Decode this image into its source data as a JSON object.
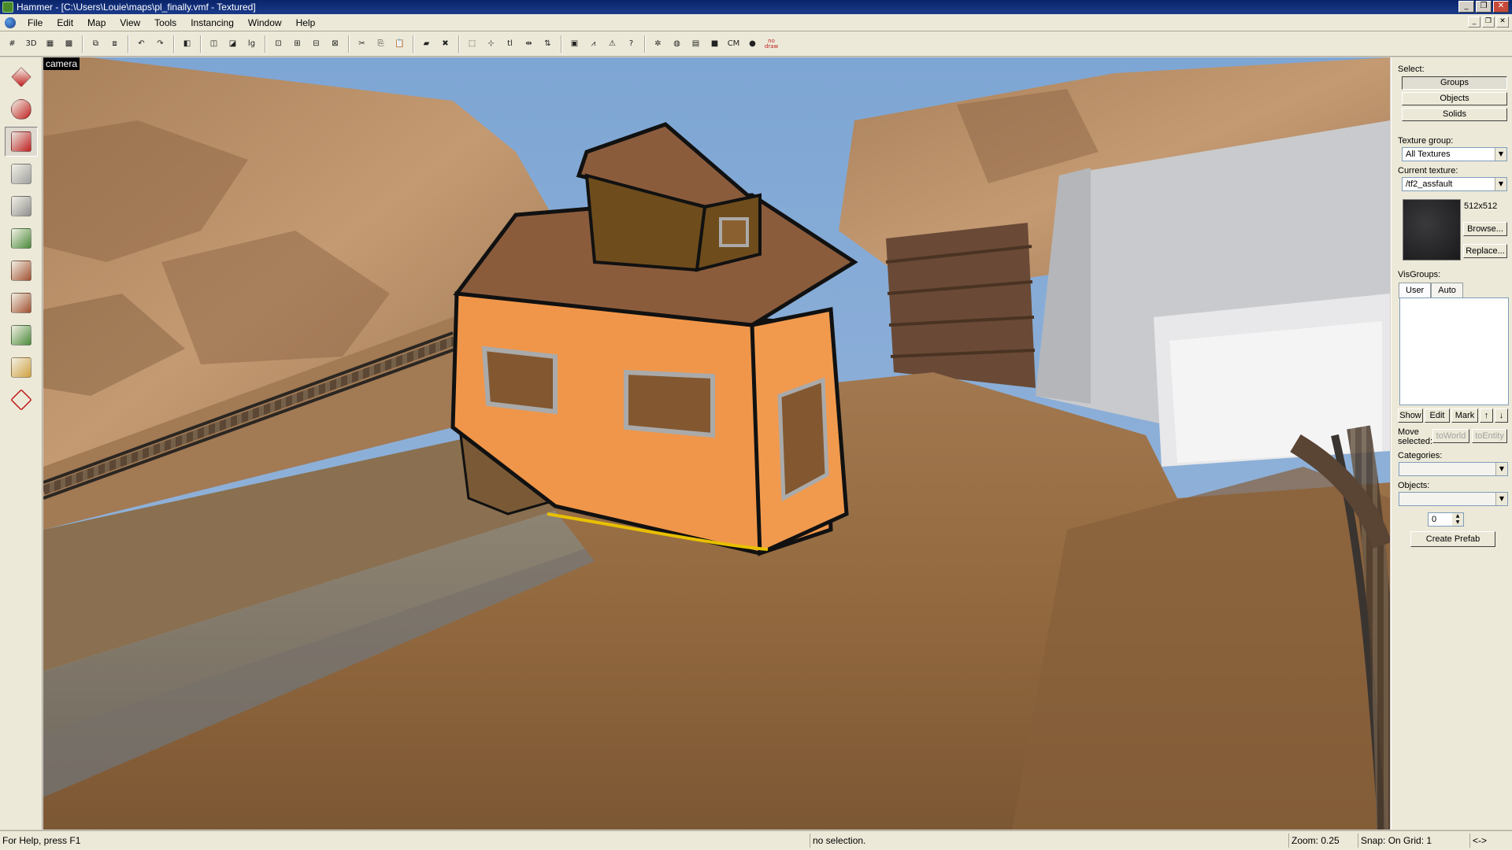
{
  "window": {
    "title": "Hammer - [C:\\Users\\Louie\\maps\\pl_finally.vmf - Textured]",
    "minimize": "_",
    "restore": "❐",
    "close": "✕"
  },
  "menu": {
    "items": [
      "File",
      "Edit",
      "Map",
      "View",
      "Tools",
      "Instancing",
      "Window",
      "Help"
    ]
  },
  "toolbar": {
    "groups": [
      [
        {
          "name": "grid-toggle-icon",
          "glyph": "#"
        },
        {
          "name": "3d-grid-icon",
          "glyph": "3D"
        },
        {
          "name": "grid-smaller-icon",
          "glyph": "▦"
        },
        {
          "name": "grid-larger-icon",
          "glyph": "▩"
        }
      ],
      [
        {
          "name": "group-icon",
          "glyph": "⧉"
        },
        {
          "name": "ungroup-icon",
          "glyph": "⧈"
        }
      ],
      [
        {
          "name": "undo-icon",
          "glyph": "↶"
        },
        {
          "name": "redo-icon",
          "glyph": "↷"
        }
      ],
      [
        {
          "name": "carve-icon",
          "glyph": "◧"
        }
      ],
      [
        {
          "name": "hide-selected-icon",
          "glyph": "◫"
        },
        {
          "name": "hide-unselected-icon",
          "glyph": "◪"
        },
        {
          "name": "show-all-icon",
          "glyph": "lg"
        }
      ],
      [
        {
          "name": "cordon-red-icon",
          "glyph": "⊡"
        },
        {
          "name": "cordon-icon",
          "glyph": "⊞"
        },
        {
          "name": "cordon-edit-icon",
          "glyph": "⊟"
        },
        {
          "name": "cordon-clear-icon",
          "glyph": "⊠"
        }
      ],
      [
        {
          "name": "cut-icon",
          "glyph": "✂"
        },
        {
          "name": "copy-icon",
          "glyph": "⎘"
        },
        {
          "name": "paste-icon",
          "glyph": "📋"
        }
      ],
      [
        {
          "name": "hazard-stripe-icon",
          "glyph": "▰"
        },
        {
          "name": "hazard-cross-icon",
          "glyph": "✖"
        }
      ],
      [
        {
          "name": "select-box-icon",
          "glyph": "⬚"
        },
        {
          "name": "select-point-icon",
          "glyph": "⊹"
        },
        {
          "name": "texture-lock-icon",
          "glyph": "tl"
        },
        {
          "name": "flip-icon",
          "glyph": "⇹"
        },
        {
          "name": "align-icon",
          "glyph": "⇅"
        }
      ],
      [
        {
          "name": "compile-icon",
          "glyph": "▣"
        },
        {
          "name": "entity-report-icon",
          "glyph": "⩘"
        },
        {
          "name": "check-problems-icon",
          "glyph": "⚠"
        },
        {
          "name": "entity-help-icon",
          "glyph": "?"
        }
      ],
      [
        {
          "name": "models-icon",
          "glyph": "✲"
        },
        {
          "name": "portal-icon",
          "glyph": "◍"
        },
        {
          "name": "overlays-icon",
          "glyph": "▤"
        },
        {
          "name": "displacement-icon",
          "glyph": "■"
        },
        {
          "name": "cubemap-icon",
          "glyph": "CM"
        },
        {
          "name": "run-icon",
          "glyph": "●"
        },
        {
          "name": "no-draw-icon",
          "glyph": "no draw"
        }
      ]
    ]
  },
  "viewport": {
    "label": "camera"
  },
  "left_tools": [
    {
      "name": "selection-tool-icon",
      "color": "#c02020"
    },
    {
      "name": "magnify-tool-icon",
      "color": "#c02020"
    },
    {
      "name": "camera-tool-icon",
      "color": "#c02020"
    },
    {
      "name": "entity-tool-icon",
      "color": "#a0a0a0"
    },
    {
      "name": "block-tool-icon",
      "color": "#909090"
    },
    {
      "name": "texture-application-icon",
      "color": "#4a8a3a"
    },
    {
      "name": "apply-texture-icon",
      "color": "#a05030"
    },
    {
      "name": "decal-tool-icon",
      "color": "#a05030"
    },
    {
      "name": "overlay-tool-icon",
      "color": "#4a8a3a"
    },
    {
      "name": "clipping-tool-icon",
      "color": "#d0a040"
    },
    {
      "name": "vertex-tool-icon",
      "color": "#c02020"
    }
  ],
  "right_panel": {
    "select_label": "Select:",
    "groups": "Groups",
    "objects": "Objects",
    "solids": "Solids",
    "texture_group_label": "Texture group:",
    "texture_group_value": "All Textures",
    "current_texture_label": "Current texture:",
    "current_texture_value": "/tf2_assfault",
    "texture_size": "512x512",
    "browse": "Browse...",
    "replace": "Replace...",
    "visgroups_label": "VisGroups:",
    "tab_user": "User",
    "tab_auto": "Auto",
    "show": "Show",
    "edit": "Edit",
    "mark": "Mark",
    "up_arrow": "↑",
    "down_arrow": "↓",
    "move_selected_label_1": "Move",
    "move_selected_label_2": "selected:",
    "to_world": "toWorld",
    "to_entity": "toEntity",
    "categories_label": "Categories:",
    "objects_label": "Objects:",
    "spin_value": "0",
    "create_prefab": "Create Prefab"
  },
  "status": {
    "help": "For Help, press F1",
    "selection": "no selection.",
    "zoom": "Zoom: 0.25",
    "snap": "Snap: On Grid: 1",
    "nav": "<->"
  }
}
